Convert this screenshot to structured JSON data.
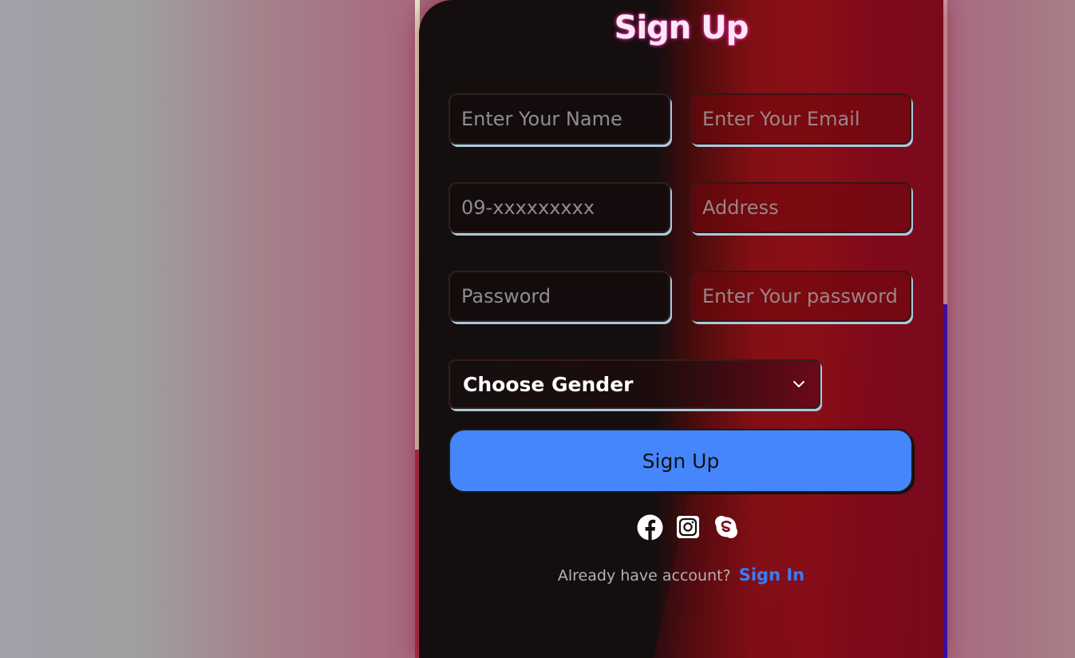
{
  "form": {
    "title": "Sign Up",
    "fields": {
      "name": {
        "placeholder": "Enter Your Name",
        "value": ""
      },
      "email": {
        "placeholder": "Enter Your Email",
        "value": ""
      },
      "phone": {
        "placeholder": "09-xxxxxxxxx",
        "value": ""
      },
      "address": {
        "placeholder": "Address",
        "value": ""
      },
      "password": {
        "placeholder": "Password",
        "value": ""
      },
      "confirm_password": {
        "placeholder": "Enter Your password",
        "value": ""
      }
    },
    "gender_select": {
      "selected": "Choose Gender"
    },
    "submit_label": "Sign Up"
  },
  "socials": [
    "facebook-icon",
    "instagram-icon",
    "skype-icon"
  ],
  "footer": {
    "prompt": "Already have account?",
    "link_label": "Sign In"
  },
  "colors": {
    "primary_button": "#4586fd",
    "link": "#3a7cf6",
    "title_glow": "#e62ea5"
  }
}
